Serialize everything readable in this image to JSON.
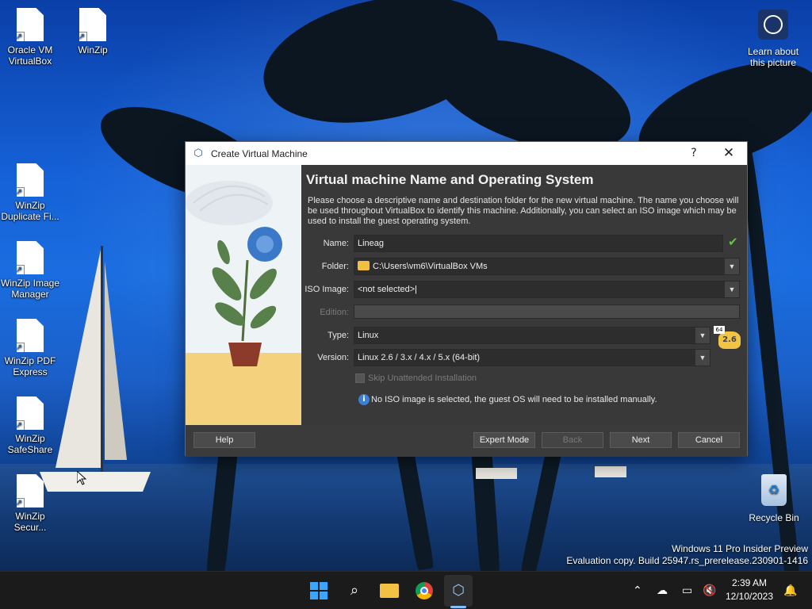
{
  "desktop": {
    "icons": [
      {
        "label": "Oracle VM\nVirtualBox"
      },
      {
        "label": "WinZip"
      },
      {
        "label": "WinZip\nDuplicate Fi..."
      },
      {
        "label": "WinZip Image\nManager"
      },
      {
        "label": "WinZip PDF\nExpress"
      },
      {
        "label": "WinZip\nSafeShare"
      },
      {
        "label": "WinZip\nSecur..."
      }
    ],
    "learn_label": "Learn about\nthis picture",
    "recycle_label": "Recycle Bin",
    "watermark_line1": "Windows 11 Pro Insider Preview",
    "watermark_line2": "Evaluation copy. Build 25947.rs_prerelease.230901-1416"
  },
  "dialog": {
    "title": "Create Virtual Machine",
    "help_symbol": "?",
    "close_symbol": "✕",
    "heading": "Virtual machine Name and Operating System",
    "description": "Please choose a descriptive name and destination folder for the new virtual machine. The name you choose will be used throughout VirtualBox to identify this machine. Additionally, you can select an ISO image which may be used to install the guest operating system.",
    "name_label": "Name:",
    "name_value": "Lineag",
    "folder_label": "Folder:",
    "folder_value": "C:\\Users\\vm6\\VirtualBox VMs",
    "iso_label": "ISO Image:",
    "iso_value": "<not selected>",
    "edition_label": "Edition:",
    "edition_value": "",
    "type_label": "Type:",
    "type_value": "Linux",
    "version_label": "Version:",
    "version_value": "Linux 2.6 / 3.x / 4.x / 5.x (64-bit)",
    "os_badge_bits": "64",
    "os_badge_version": "2.6",
    "skip_unattended_label": "Skip Unattended Installation",
    "info_text": "No ISO image is selected, the guest OS will need to be installed manually.",
    "buttons": {
      "help": "Help",
      "expert": "Expert Mode",
      "back": "Back",
      "next": "Next",
      "cancel": "Cancel"
    }
  },
  "taskbar": {
    "time": "2:39 AM",
    "date": "12/10/2023"
  },
  "colors": {
    "accent": "#3ba6ff",
    "dialog_bg": "#393939",
    "check_green": "#5ccb3a"
  }
}
